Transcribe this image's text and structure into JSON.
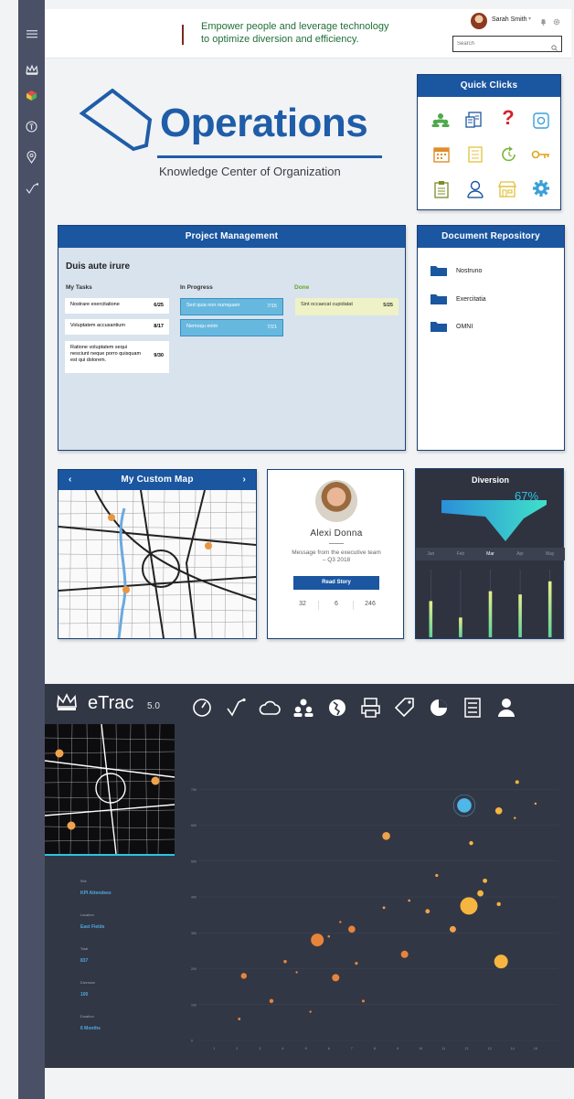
{
  "header": {
    "tagline_line1": "Empower people and leverage technology",
    "tagline_line2": "to optimize diversion and efficiency.",
    "user_name": "Sarah Smith",
    "search_placeholder": "Search"
  },
  "sidebar": {
    "items": [
      {
        "icon": "menu-icon"
      },
      {
        "icon": "crown-icon"
      },
      {
        "icon": "cube-icon"
      },
      {
        "icon": "info-icon"
      },
      {
        "icon": "location-pin-icon"
      },
      {
        "icon": "route-icon"
      }
    ]
  },
  "hero": {
    "title": "Operations",
    "subtitle": "Knowledge Center of Organization"
  },
  "quick_clicks": {
    "title": "Quick Clicks",
    "icons": [
      "people-icon",
      "document-list-icon",
      "help-icon",
      "camera-icon",
      "calendar-icon",
      "checklist-icon",
      "refresh-icon",
      "key-icon",
      "clipboard-icon",
      "user-icon",
      "store-icon",
      "settings-icon"
    ]
  },
  "project_management": {
    "header": "Project Management",
    "title": "Duis aute irure",
    "columns": {
      "todo": "My Tasks",
      "progress": "In Progress",
      "done": "Done"
    },
    "my_tasks": [
      {
        "text": "Nostrare exercitatione",
        "num": "6/25"
      },
      {
        "text": "Voluptatem accusantium",
        "num": "8/17"
      },
      {
        "text": "Ratione voluptatem sequi nesciunt neque porro quisquam est qui dolorem.",
        "num": "9/30"
      }
    ],
    "in_progress": [
      {
        "text": "Sed quia non numquam",
        "num": "7/15"
      },
      {
        "text": "Nemoqu enim",
        "num": "7/21"
      }
    ],
    "done": [
      {
        "text": "Sint occaecat cupidatat",
        "num": "5/25"
      }
    ]
  },
  "documents": {
    "title": "Document Repository",
    "items": [
      "Nostruno",
      "Exercitatia",
      "OMNI"
    ]
  },
  "map": {
    "title": "My Custom Map"
  },
  "executive": {
    "name": "Alexi Donna",
    "message": "Message from the executive team – Q3 2018",
    "button": "Read Story",
    "stats": [
      "32",
      "6",
      "246"
    ]
  },
  "diversion": {
    "title": "Diversion",
    "percent": "67%",
    "months": [
      "Jan",
      "Feb",
      "Mar",
      "Apr",
      "May"
    ],
    "active_month": "Mar",
    "bars": [
      0.55,
      0.3,
      0.7,
      0.65,
      0.85
    ],
    "colors": {
      "bar_top": "#e6f08a",
      "bar_bottom": "#5fd39a"
    }
  },
  "etrac": {
    "brand": "eTrac",
    "version": "5.0",
    "tools": [
      "gauge-icon",
      "route-icon",
      "cloud-icon",
      "people-icon",
      "globe-icon",
      "printer-icon",
      "tag-icon",
      "pie-chart-icon",
      "list-icon",
      "user-icon"
    ],
    "fields": [
      {
        "label": "Site",
        "value": "KPI Attendees"
      },
      {
        "label": "Location",
        "value": "East Fields"
      },
      {
        "label": "Total",
        "value": "837"
      },
      {
        "label": "Diversion",
        "value": "100"
      },
      {
        "label": "Duration",
        "value": "6 Months"
      }
    ],
    "accent": "#2bc3e6"
  },
  "chart_data": {
    "type": "scatter",
    "x_ticks": [
      "1",
      "2",
      "3",
      "4",
      "5",
      "6",
      "7",
      "8",
      "9",
      "10",
      "11",
      "12",
      "13",
      "14",
      "15"
    ],
    "y_ticks": [
      "0",
      "100",
      "200",
      "300",
      "400",
      "500",
      "600",
      "700"
    ],
    "xlim": [
      0,
      16
    ],
    "ylim": [
      0,
      800
    ],
    "points": [
      {
        "x": 2.1,
        "y": 60,
        "r": 1.4,
        "c": "#e8843a"
      },
      {
        "x": 2.3,
        "y": 180,
        "r": 3.2,
        "c": "#e8843a"
      },
      {
        "x": 3.5,
        "y": 110,
        "r": 2.2,
        "c": "#e8843a"
      },
      {
        "x": 4.1,
        "y": 220,
        "r": 1.8,
        "c": "#e8843a"
      },
      {
        "x": 4.6,
        "y": 190,
        "r": 1.2,
        "c": "#e8843a"
      },
      {
        "x": 5.2,
        "y": 80,
        "r": 1.2,
        "c": "#e8843a"
      },
      {
        "x": 5.5,
        "y": 280,
        "r": 7.0,
        "c": "#e8843a"
      },
      {
        "x": 6.0,
        "y": 290,
        "r": 1.3,
        "c": "#e8843a"
      },
      {
        "x": 6.3,
        "y": 175,
        "r": 4.0,
        "c": "#e8843a"
      },
      {
        "x": 6.5,
        "y": 330,
        "r": 1.2,
        "c": "#e8843a"
      },
      {
        "x": 7.0,
        "y": 310,
        "r": 3.8,
        "c": "#e8843a"
      },
      {
        "x": 7.2,
        "y": 215,
        "r": 1.6,
        "c": "#e8843a"
      },
      {
        "x": 7.5,
        "y": 110,
        "r": 1.5,
        "c": "#e8843a"
      },
      {
        "x": 8.4,
        "y": 370,
        "r": 1.4,
        "c": "#f0a24a"
      },
      {
        "x": 8.5,
        "y": 570,
        "r": 4.3,
        "c": "#f0a24a"
      },
      {
        "x": 9.3,
        "y": 240,
        "r": 4.0,
        "c": "#e8843a"
      },
      {
        "x": 9.5,
        "y": 390,
        "r": 1.3,
        "c": "#f0a24a"
      },
      {
        "x": 10.3,
        "y": 360,
        "r": 2.4,
        "c": "#f0a24a"
      },
      {
        "x": 10.7,
        "y": 460,
        "r": 1.6,
        "c": "#f0a24a"
      },
      {
        "x": 11.4,
        "y": 310,
        "r": 3.5,
        "c": "#f0a24a"
      },
      {
        "x": 11.9,
        "y": 655,
        "r": 7.8,
        "c": "#4fb6e8"
      },
      {
        "x": 12.1,
        "y": 375,
        "r": 9.5,
        "c": "#f6b540"
      },
      {
        "x": 12.2,
        "y": 550,
        "r": 2.2,
        "c": "#f6b540"
      },
      {
        "x": 12.6,
        "y": 410,
        "r": 3.4,
        "c": "#f6b540"
      },
      {
        "x": 12.8,
        "y": 445,
        "r": 2.4,
        "c": "#f6b540"
      },
      {
        "x": 13.4,
        "y": 640,
        "r": 3.8,
        "c": "#f6b540"
      },
      {
        "x": 13.5,
        "y": 220,
        "r": 7.5,
        "c": "#f6b540"
      },
      {
        "x": 14.2,
        "y": 720,
        "r": 2.0,
        "c": "#f6b540"
      },
      {
        "x": 14.1,
        "y": 620,
        "r": 1.2,
        "c": "#f6b540"
      },
      {
        "x": 13.4,
        "y": 380,
        "r": 2.2,
        "c": "#f6b540"
      },
      {
        "x": 15.0,
        "y": 660,
        "r": 1.2,
        "c": "#f6b540"
      }
    ]
  }
}
